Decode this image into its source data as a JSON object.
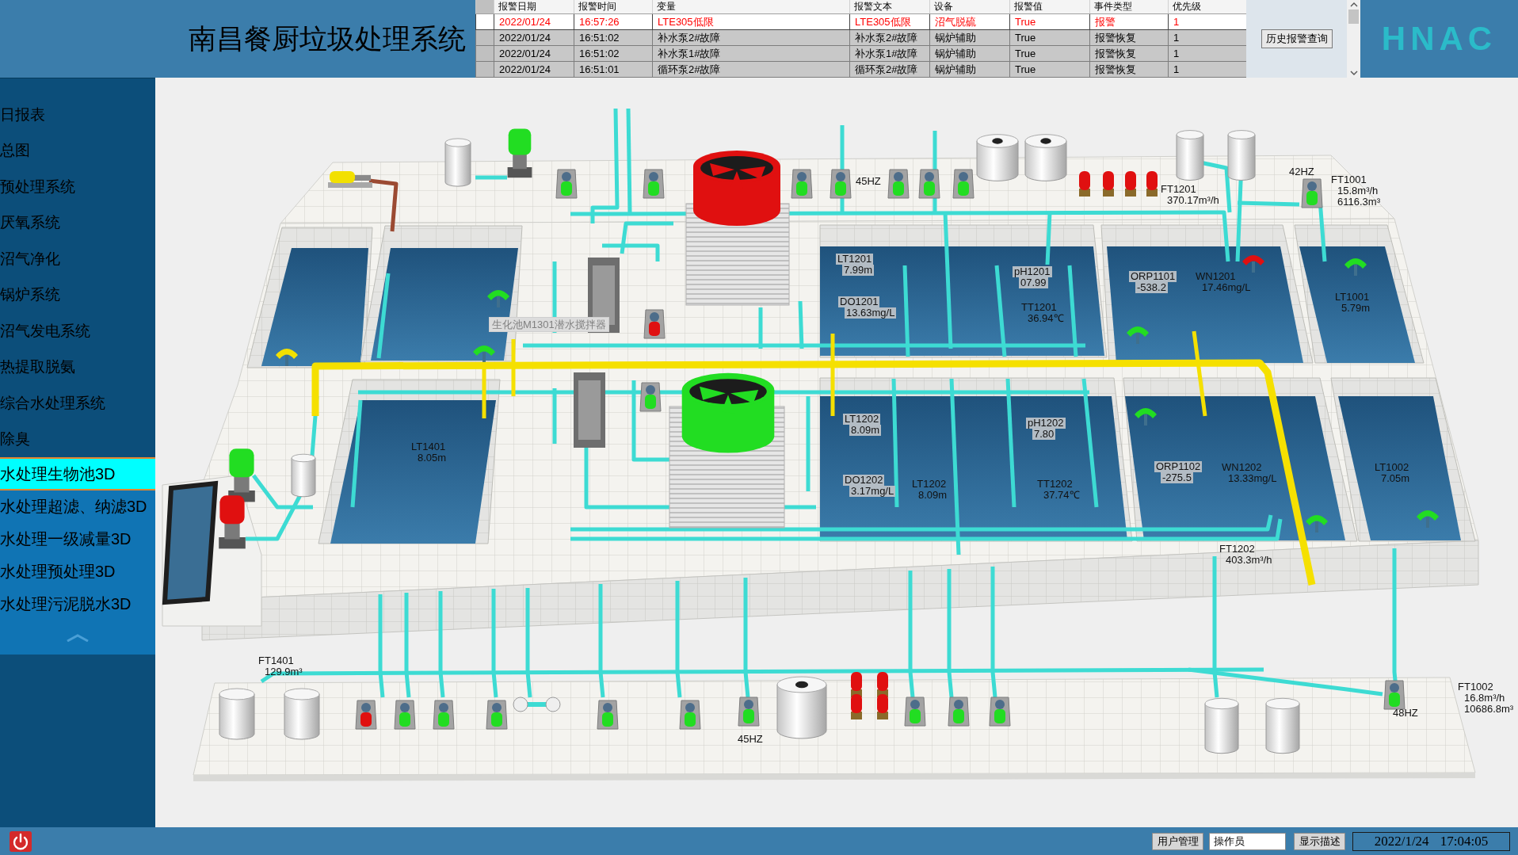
{
  "header": {
    "title": "南昌餐厨垃圾处理系统",
    "logo": "HNAC"
  },
  "alarm_table": {
    "columns": [
      "报警日期",
      "报警时间",
      "变量",
      "报警文本",
      "设备",
      "报警值",
      "事件类型",
      "优先级"
    ],
    "rows": [
      {
        "active": true,
        "cells": [
          "2022/01/24",
          "16:57:26",
          "LTE305低限",
          "LTE305低限",
          "沼气脱硫",
          "True",
          "报警",
          "1"
        ]
      },
      {
        "active": false,
        "cells": [
          "2022/01/24",
          "16:51:02",
          "补水泵2#故障",
          "补水泵2#故障",
          "锅炉辅助",
          "True",
          "报警恢复",
          "1"
        ]
      },
      {
        "active": false,
        "cells": [
          "2022/01/24",
          "16:51:02",
          "补水泵1#故障",
          "补水泵1#故障",
          "锅炉辅助",
          "True",
          "报警恢复",
          "1"
        ]
      },
      {
        "active": false,
        "cells": [
          "2022/01/24",
          "16:51:01",
          "循环泵2#故障",
          "循环泵2#故障",
          "锅炉辅助",
          "True",
          "报警恢复",
          "1"
        ]
      }
    ],
    "history_button": "历史报警查询"
  },
  "sidebar": {
    "sections": [
      {
        "kind": "system",
        "items": [
          {
            "label": "日报表",
            "selected": false
          },
          {
            "label": "总图",
            "selected": false
          },
          {
            "label": "预处理系统",
            "selected": false
          },
          {
            "label": "厌氧系统",
            "selected": false
          },
          {
            "label": "沼气净化",
            "selected": false
          },
          {
            "label": "锅炉系统",
            "selected": false
          },
          {
            "label": "沼气发电系统",
            "selected": false
          },
          {
            "label": "热提取脱氨",
            "selected": false
          },
          {
            "label": "综合水处理系统",
            "selected": false
          },
          {
            "label": "除臭",
            "selected": false
          }
        ]
      },
      {
        "kind": "model3d",
        "items": [
          {
            "label": "水处理生物池3D",
            "selected": true
          },
          {
            "label": "水处理超滤、纳滤3D",
            "selected": false
          },
          {
            "label": "水处理一级减量3D",
            "selected": false
          },
          {
            "label": "水处理预处理3D",
            "selected": false
          },
          {
            "label": "水处理污泥脱水3D",
            "selected": false
          }
        ]
      }
    ]
  },
  "plant": {
    "tooltip": "生化池M1301潜水搅拌器",
    "labels": [
      {
        "tag": "45HZ",
        "boxed": false
      },
      {
        "tag": "FT1201",
        "values": [
          "370.17m³/h"
        ],
        "boxed": false
      },
      {
        "tag": "42HZ",
        "boxed": false
      },
      {
        "tag": "FT1001",
        "values": [
          "15.8m³/h",
          "6116.3m³"
        ],
        "boxed": false
      },
      {
        "tag": "LT1201",
        "values": [
          "7.99m"
        ],
        "boxed": true
      },
      {
        "tag": "pH1201",
        "values": [
          "07.99"
        ],
        "boxed": true
      },
      {
        "tag": "DO1201",
        "values": [
          "13.63mg/L"
        ],
        "boxed": true
      },
      {
        "tag": "TT1201",
        "values": [
          "36.94℃"
        ],
        "boxed": false
      },
      {
        "tag": "ORP1101",
        "values": [
          "-538.2"
        ],
        "boxed": true
      },
      {
        "tag": "WN1201",
        "values": [
          "17.46mg/L"
        ],
        "boxed": false
      },
      {
        "tag": "LT1001",
        "values": [
          "5.79m"
        ],
        "boxed": false
      },
      {
        "tag": "LT1202",
        "values": [
          "8.09m"
        ],
        "boxed": true
      },
      {
        "tag": "pH1202",
        "values": [
          "7.80"
        ],
        "boxed": true
      },
      {
        "tag": "DO1202",
        "values": [
          "3.17mg/L"
        ],
        "boxed": true
      },
      {
        "tag": "LT1202",
        "values": [
          "8.09m"
        ],
        "boxed": false
      },
      {
        "tag": "TT1202",
        "values": [
          "37.74℃"
        ],
        "boxed": false
      },
      {
        "tag": "ORP1102",
        "values": [
          "-275.5"
        ],
        "boxed": true
      },
      {
        "tag": "WN1202",
        "values": [
          "13.33mg/L"
        ],
        "boxed": false
      },
      {
        "tag": "LT1002",
        "values": [
          "7.05m"
        ],
        "boxed": false
      },
      {
        "tag": "FT1202",
        "values": [
          "403.3m³/h"
        ],
        "boxed": false
      },
      {
        "tag": "LT1401",
        "values": [
          "8.05m"
        ],
        "boxed": false
      },
      {
        "tag": "FT1401",
        "values": [
          "129.9m³"
        ],
        "boxed": false
      },
      {
        "tag": "45HZ",
        "boxed": false
      },
      {
        "tag": "FT1002",
        "values": [
          "16.8m³/h",
          "10686.8m³"
        ],
        "boxed": false
      },
      {
        "tag": "48HZ",
        "boxed": false
      }
    ],
    "equipment": [
      {
        "kind": "fan",
        "color": "#e01010"
      },
      {
        "kind": "fan",
        "color": "#22dd22"
      },
      {
        "kind": "screw-pump",
        "color": "#f2e000"
      },
      {
        "kind": "vertical-pump",
        "color": "#22dd22"
      },
      {
        "kind": "pump",
        "color": "#22dd22"
      },
      {
        "kind": "pump",
        "color": "#22dd22"
      },
      {
        "kind": "pump",
        "color": "#22dd22"
      },
      {
        "kind": "pump",
        "color": "#22dd22"
      },
      {
        "kind": "pump",
        "color": "#22dd22"
      },
      {
        "kind": "pump",
        "color": "#22dd22"
      },
      {
        "kind": "pump",
        "color": "#22dd22"
      },
      {
        "kind": "dosing-pump",
        "color": "#e01010"
      },
      {
        "kind": "dosing-pump",
        "color": "#e01010"
      },
      {
        "kind": "dosing-pump",
        "color": "#e01010"
      },
      {
        "kind": "dosing-pump",
        "color": "#e01010"
      },
      {
        "kind": "pump",
        "color": "#22dd22"
      },
      {
        "kind": "pump",
        "color": "#e01010"
      },
      {
        "kind": "pump",
        "color": "#22dd22"
      },
      {
        "kind": "vertical-pump",
        "color": "#22dd22"
      },
      {
        "kind": "vertical-pump",
        "color": "#e01010"
      },
      {
        "kind": "mixer",
        "color": "#f2e000"
      },
      {
        "kind": "mixer",
        "color": "#22dd22"
      },
      {
        "kind": "mixer",
        "color": "#22dd22"
      },
      {
        "kind": "mixer",
        "color": "#22dd22"
      },
      {
        "kind": "mixer",
        "color": "#e01010"
      },
      {
        "kind": "mixer",
        "color": "#22dd22"
      },
      {
        "kind": "mixer",
        "color": "#22dd22"
      },
      {
        "kind": "mixer",
        "color": "#22dd22"
      },
      {
        "kind": "mixer",
        "color": "#22dd22"
      },
      {
        "kind": "pump",
        "color": "#e01010"
      },
      {
        "kind": "pump",
        "color": "#22dd22"
      },
      {
        "kind": "pump",
        "color": "#22dd22"
      },
      {
        "kind": "pump",
        "color": "#22dd22"
      },
      {
        "kind": "pump",
        "color": "#22dd22"
      },
      {
        "kind": "pump",
        "color": "#22dd22"
      },
      {
        "kind": "pump",
        "color": "#22dd22"
      },
      {
        "kind": "dosing-pump",
        "color": "#e01010"
      },
      {
        "kind": "dosing-pump",
        "color": "#e01010"
      },
      {
        "kind": "dosing-pump",
        "color": "#e01010"
      },
      {
        "kind": "dosing-pump",
        "color": "#e01010"
      },
      {
        "kind": "pump",
        "color": "#22dd22"
      },
      {
        "kind": "pump",
        "color": "#22dd22"
      },
      {
        "kind": "pump",
        "color": "#22dd22"
      },
      {
        "kind": "pump",
        "color": "#22dd22"
      }
    ]
  },
  "status_bar": {
    "user_button": "用户管理",
    "user_field": "操作员",
    "describe_button": "显示描述",
    "datetime": "2022/1/24 17:04:05"
  }
}
